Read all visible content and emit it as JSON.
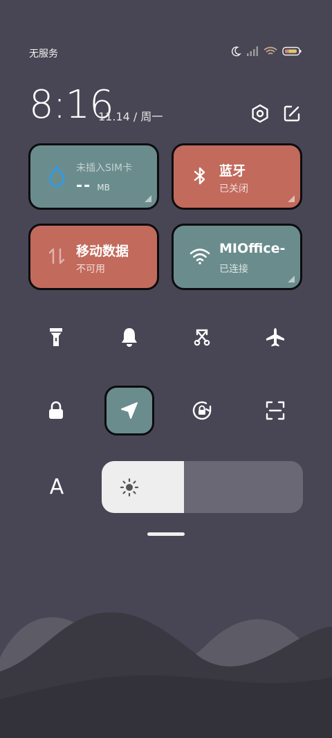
{
  "status_bar": {
    "carrier": "无服务",
    "icons": [
      "moon-icon",
      "signal-icon",
      "wifi-icon",
      "battery-icon"
    ]
  },
  "header": {
    "time": "8:16",
    "date": "11.14 / 周一",
    "icons": [
      "settings-icon",
      "edit-icon"
    ]
  },
  "tiles": {
    "sim": {
      "title": "未插入SIM卡",
      "value": "--",
      "unit": "MB",
      "icon": "droplet-icon"
    },
    "bluetooth": {
      "title": "蓝牙",
      "status": "已关闭",
      "icon": "bluetooth-icon"
    },
    "mobile_data": {
      "title": "移动数据",
      "status": "不可用",
      "icon": "data-arrows-icon"
    },
    "wifi": {
      "title": "MIOffice-",
      "status": "已连接",
      "icon": "wifi-icon"
    }
  },
  "quick_toggles": {
    "row1": [
      "flashlight-icon",
      "bell-icon",
      "screenshot-icon",
      "airplane-icon"
    ],
    "row2": [
      "lock-icon",
      "location-icon",
      "rotation-lock-icon",
      "scan-icon"
    ]
  },
  "brightness": {
    "auto_label": "A",
    "level": 0.41
  },
  "colors": {
    "background": "#484654",
    "tile_teal": "#6a8c8d",
    "tile_red": "#c26a5c",
    "slider_fill": "#eeeeee",
    "slider_track": "#6a6874",
    "sim_icon": "#2f9be8"
  }
}
